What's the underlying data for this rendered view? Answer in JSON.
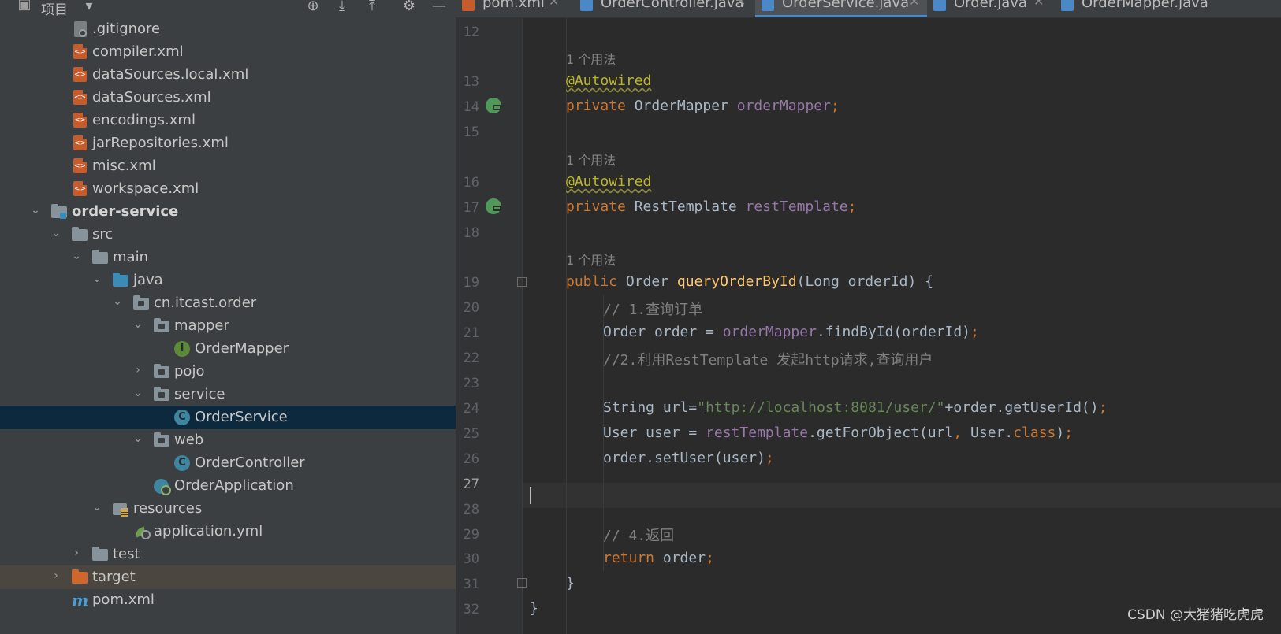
{
  "project_panel": {
    "title": "项目",
    "tree": [
      {
        "label": ".gitignore",
        "icon": "gitignore-file-icon"
      },
      {
        "label": "compiler.xml",
        "icon": "xml-file-icon"
      },
      {
        "label": "dataSources.local.xml",
        "icon": "xml-file-icon"
      },
      {
        "label": "dataSources.xml",
        "icon": "xml-file-icon"
      },
      {
        "label": "encodings.xml",
        "icon": "xml-file-icon"
      },
      {
        "label": "jarRepositories.xml",
        "icon": "xml-file-icon"
      },
      {
        "label": "misc.xml",
        "icon": "xml-file-icon"
      },
      {
        "label": "workspace.xml",
        "icon": "xml-file-icon"
      },
      {
        "label": "order-service",
        "icon": "module-folder-icon",
        "expanded": true
      },
      {
        "label": "src",
        "icon": "folder-icon",
        "expanded": true
      },
      {
        "label": "main",
        "icon": "folder-icon",
        "expanded": true
      },
      {
        "label": "java",
        "icon": "source-folder-icon",
        "expanded": true
      },
      {
        "label": "cn.itcast.order",
        "icon": "package-icon",
        "expanded": true
      },
      {
        "label": "mapper",
        "icon": "package-icon",
        "expanded": true
      },
      {
        "label": "OrderMapper",
        "icon": "interface-icon"
      },
      {
        "label": "pojo",
        "icon": "package-icon",
        "expanded": false
      },
      {
        "label": "service",
        "icon": "package-icon",
        "expanded": true
      },
      {
        "label": "OrderService",
        "icon": "class-icon",
        "selected": true
      },
      {
        "label": "web",
        "icon": "package-icon",
        "expanded": true
      },
      {
        "label": "OrderController",
        "icon": "class-icon"
      },
      {
        "label": "OrderApplication",
        "icon": "spring-app-icon"
      },
      {
        "label": "resources",
        "icon": "resources-folder-icon",
        "expanded": true
      },
      {
        "label": "application.yml",
        "icon": "yml-file-icon"
      },
      {
        "label": "test",
        "icon": "folder-icon",
        "expanded": false
      },
      {
        "label": "target",
        "icon": "excluded-folder-icon",
        "expanded": false
      },
      {
        "label": "pom.xml",
        "icon": "maven-icon"
      }
    ]
  },
  "tabs": [
    {
      "label": "pom.xml",
      "icon": "maven-icon"
    },
    {
      "label": "OrderController.java",
      "icon": "java-file-icon"
    },
    {
      "label": "OrderService.java",
      "icon": "java-file-icon",
      "active": true
    },
    {
      "label": "Order.java",
      "icon": "java-file-icon"
    },
    {
      "label": "OrderMapper.java",
      "icon": "java-file-icon"
    }
  ],
  "editor": {
    "current_line": 27,
    "usage_hint": "1 个用法",
    "lines": {
      "12": "",
      "13": "@Autowired",
      "14": "private OrderMapper orderMapper;",
      "15": "",
      "16": "@Autowired",
      "17": "private RestTemplate restTemplate;",
      "18": "",
      "19": "public Order queryOrderById(Long orderId) {",
      "20": "// 1.查询订单",
      "21": "Order order = orderMapper.findById(orderId);",
      "22": "//2.利用RestTemplate 发起http请求,查询用户",
      "23": "",
      "24": "String url=\"http://localhost:8081/user/\"+order.getUserId();",
      "25": "User user = restTemplate.getForObject(url, User.class);",
      "26": "order.setUser(user);",
      "27": "",
      "28": "",
      "29": "// 4.返回",
      "30": "return order;",
      "31": "}",
      "32": "}"
    },
    "code_tokens": {
      "l13": [
        "@Autowired"
      ],
      "l14": [
        "private",
        " OrderMapper ",
        "orderMapper",
        ";"
      ],
      "l16": [
        "@Autowired"
      ],
      "l17": [
        "private",
        " RestTemplate ",
        "restTemplate",
        ";"
      ],
      "l19": [
        "public",
        " Order ",
        "queryOrderById",
        "(Long orderId) {"
      ],
      "l20": [
        "// 1.查询订单"
      ],
      "l21": [
        "Order order = ",
        "orderMapper",
        ".findById(orderId)",
        ";"
      ],
      "l22": [
        "//2.利用RestTemplate 发起http请求,查询用户"
      ],
      "l24": [
        "String url=",
        "\"",
        "http://localhost:8081/user/",
        "\"",
        "+order.getUserId()",
        ";"
      ],
      "l25": [
        "User user = ",
        "restTemplate",
        ".getForObject(url",
        ", ",
        "User.",
        "class",
        ")",
        ";"
      ],
      "l26": [
        "order.setUser(user)",
        ";"
      ],
      "l29": [
        "// 4.返回"
      ],
      "l30": [
        "return",
        " order",
        ";"
      ],
      "l31": [
        "}"
      ],
      "l32": [
        "}"
      ]
    },
    "line_numbers": [
      "12",
      "13",
      "14",
      "15",
      "16",
      "17",
      "18",
      "19",
      "20",
      "21",
      "22",
      "23",
      "24",
      "25",
      "26",
      "27",
      "28",
      "29",
      "30",
      "31",
      "32"
    ]
  },
  "watermark": "CSDN @大猪猪吃虎虎",
  "colors": {
    "panel_bg": "#3c3f41",
    "editor_bg": "#2b2b2b",
    "selection": "#0d293e",
    "keyword": "#cc7832",
    "annotation": "#bbb529",
    "field": "#9876aa",
    "method": "#ffc66d",
    "comment": "#808080",
    "string": "#6a8759"
  }
}
